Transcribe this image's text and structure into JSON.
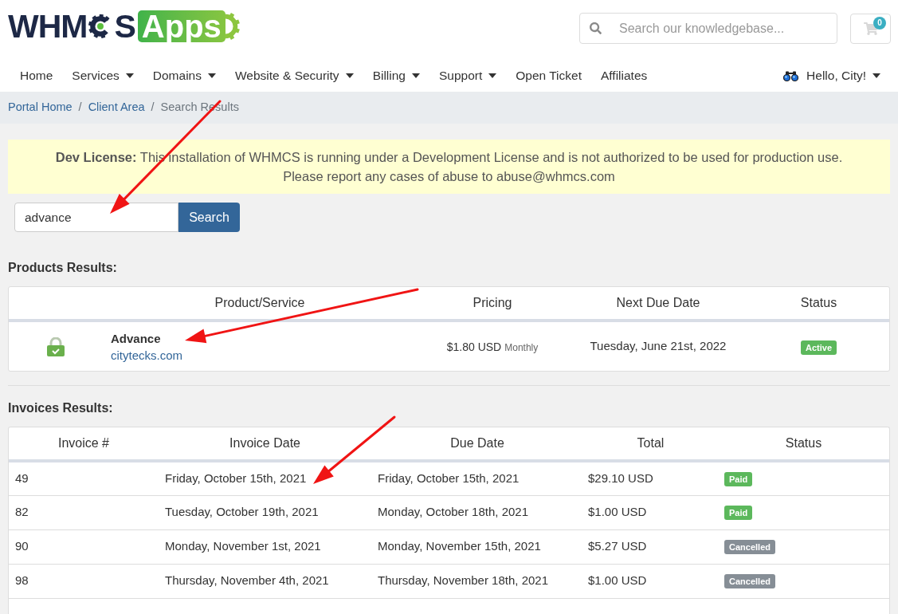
{
  "header": {
    "logo": {
      "text_left": "WHM",
      "text_right": "S",
      "badge": "Apps"
    },
    "search": {
      "placeholder": "Search our knowledgebase..."
    },
    "cart": {
      "count": "0"
    }
  },
  "nav": {
    "items": [
      {
        "label": "Home",
        "has_menu": false
      },
      {
        "label": "Services",
        "has_menu": true
      },
      {
        "label": "Domains",
        "has_menu": true
      },
      {
        "label": "Website & Security",
        "has_menu": true
      },
      {
        "label": "Billing",
        "has_menu": true
      },
      {
        "label": "Support",
        "has_menu": true
      },
      {
        "label": "Open Ticket",
        "has_menu": false
      },
      {
        "label": "Affiliates",
        "has_menu": false
      }
    ],
    "user": {
      "label": "Hello, City!",
      "has_menu": true
    }
  },
  "breadcrumb": {
    "separator": "/",
    "items": [
      {
        "label": "Portal Home",
        "current": false
      },
      {
        "label": "Client Area",
        "current": false
      },
      {
        "label": "Search Results",
        "current": true
      }
    ]
  },
  "alert": {
    "lines": [
      "**Dev License:** This installation of WHMCS is running under a Development License and is not authorized to be used for production use.",
      "Please report any cases of abuse to abuse@whmcs.com"
    ]
  },
  "search_form": {
    "value": "advance",
    "button": "Search"
  },
  "products": {
    "title": "Products Results:",
    "columns": [
      "Product/Service",
      "Pricing",
      "Next Due Date",
      "Status"
    ],
    "rows": [
      {
        "name": "Advance",
        "domain": "citytecks.com",
        "price": "$1.80 USD",
        "cycle": "Monthly",
        "next_due": "Tuesday, June 21st, 2022",
        "status": {
          "label": "Active",
          "color": "#5cb85c"
        }
      }
    ]
  },
  "invoices": {
    "title": "Invoices Results:",
    "columns": [
      "Invoice #",
      "Invoice Date",
      "Due Date",
      "Total",
      "Status"
    ],
    "rows": [
      {
        "number": "49",
        "date": "Friday, October 15th, 2021",
        "due": "Friday, October 15th, 2021",
        "total": "$29.10 USD",
        "status": {
          "label": "Paid",
          "color": "#5cb85c"
        }
      },
      {
        "number": "82",
        "date": "Tuesday, October 19th, 2021",
        "due": "Monday, October 18th, 2021",
        "total": "$1.00 USD",
        "status": {
          "label": "Paid",
          "color": "#5cb85c"
        }
      },
      {
        "number": "90",
        "date": "Monday, November 1st, 2021",
        "due": "Monday, November 15th, 2021",
        "total": "$5.27 USD",
        "status": {
          "label": "Cancelled",
          "color": "#868e96"
        }
      },
      {
        "number": "98",
        "date": "Thursday, November 4th, 2021",
        "due": "Thursday, November 18th, 2021",
        "total": "$1.00 USD",
        "status": {
          "label": "Cancelled",
          "color": "#868e96"
        }
      }
    ]
  }
}
